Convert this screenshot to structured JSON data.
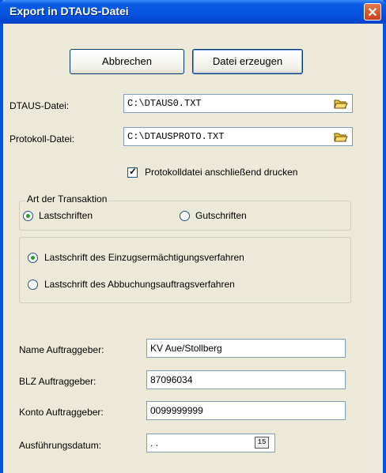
{
  "window": {
    "title": "Export in DTAUS-Datei",
    "close_glyph": "✕"
  },
  "toolbar": {
    "cancel_label": "Abbrechen",
    "create_label": "Datei erzeugen"
  },
  "files": {
    "dtaus_label": "DTAUS-Datei:",
    "dtaus_value": "C:\\DTAUS0.TXT",
    "protocol_label": "Protokoll-Datei:",
    "protocol_value": "C:\\DTAUSPROTO.TXT",
    "browse_icon": "folder-open-icon"
  },
  "print_protocol": {
    "label": "Protokolldatei anschließend drucken",
    "checked": true
  },
  "transaction": {
    "legend": "Art der Transaktion",
    "options": [
      {
        "label": "Lastschriften",
        "selected": true
      },
      {
        "label": "Gutschriften",
        "selected": false
      }
    ]
  },
  "procedure": {
    "options": [
      {
        "label": "Lastschrift des Einzugsermächtigungsverfahren",
        "selected": true
      },
      {
        "label": "Lastschrift des Abbuchungsauftragsverfahren",
        "selected": false
      }
    ]
  },
  "client": {
    "name_label": "Name Auftraggeber:",
    "name_value": "KV Aue/Stollberg",
    "blz_label": "BLZ Auftraggeber:",
    "blz_value": "87096034",
    "account_label": "Konto Auftraggeber:",
    "account_value": "0099999999",
    "date_label": "Ausführungsdatum:",
    "date_value": " .  .",
    "calendar_glyph": "15"
  },
  "colors": {
    "titlebar": "#0a5be4",
    "window_bg": "#ece9d8",
    "radio_dot": "#21a121"
  }
}
